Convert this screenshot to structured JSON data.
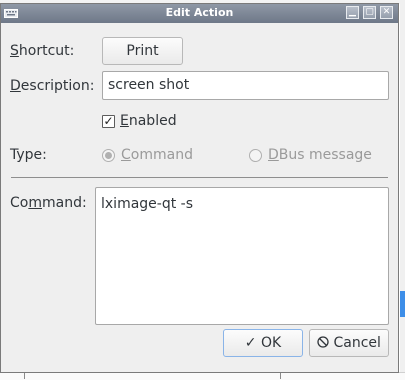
{
  "window": {
    "title": "Edit Action",
    "buttons": {
      "minimize": "▁",
      "maximize": "▢",
      "close": "✕"
    }
  },
  "form": {
    "shortcut": {
      "label_mnemonic": "S",
      "label_rest": "hortcut:",
      "value": "Print"
    },
    "description": {
      "label_mnemonic": "D",
      "label_rest": "escription:",
      "value": "screen shot"
    },
    "enabled": {
      "label_mnemonic": "E",
      "label_rest": "nabled",
      "checked": true,
      "check_glyph": "✓"
    },
    "type": {
      "label": "Type:",
      "options": [
        {
          "mnemonic": "C",
          "rest": "ommand",
          "selected": true,
          "enabled": false
        },
        {
          "mnemonic": "D",
          "rest": "Bus message",
          "selected": false,
          "enabled": false
        }
      ]
    },
    "command": {
      "label_pre": "Co",
      "label_mnemonic": "m",
      "label_post": "mand:",
      "value": "lximage-qt -s"
    }
  },
  "actions": {
    "ok": {
      "icon": "✓",
      "label": "OK"
    },
    "cancel": {
      "icon": "⃠",
      "label": "Cancel"
    }
  },
  "colors": {
    "titlebar": "#7b8595",
    "dialog_bg": "#efefef",
    "accent": "#3d8ee8"
  },
  "icons": {
    "window_menu": "keyboard-icon",
    "ok": "checkmark-icon",
    "cancel": "cancel-icon"
  }
}
